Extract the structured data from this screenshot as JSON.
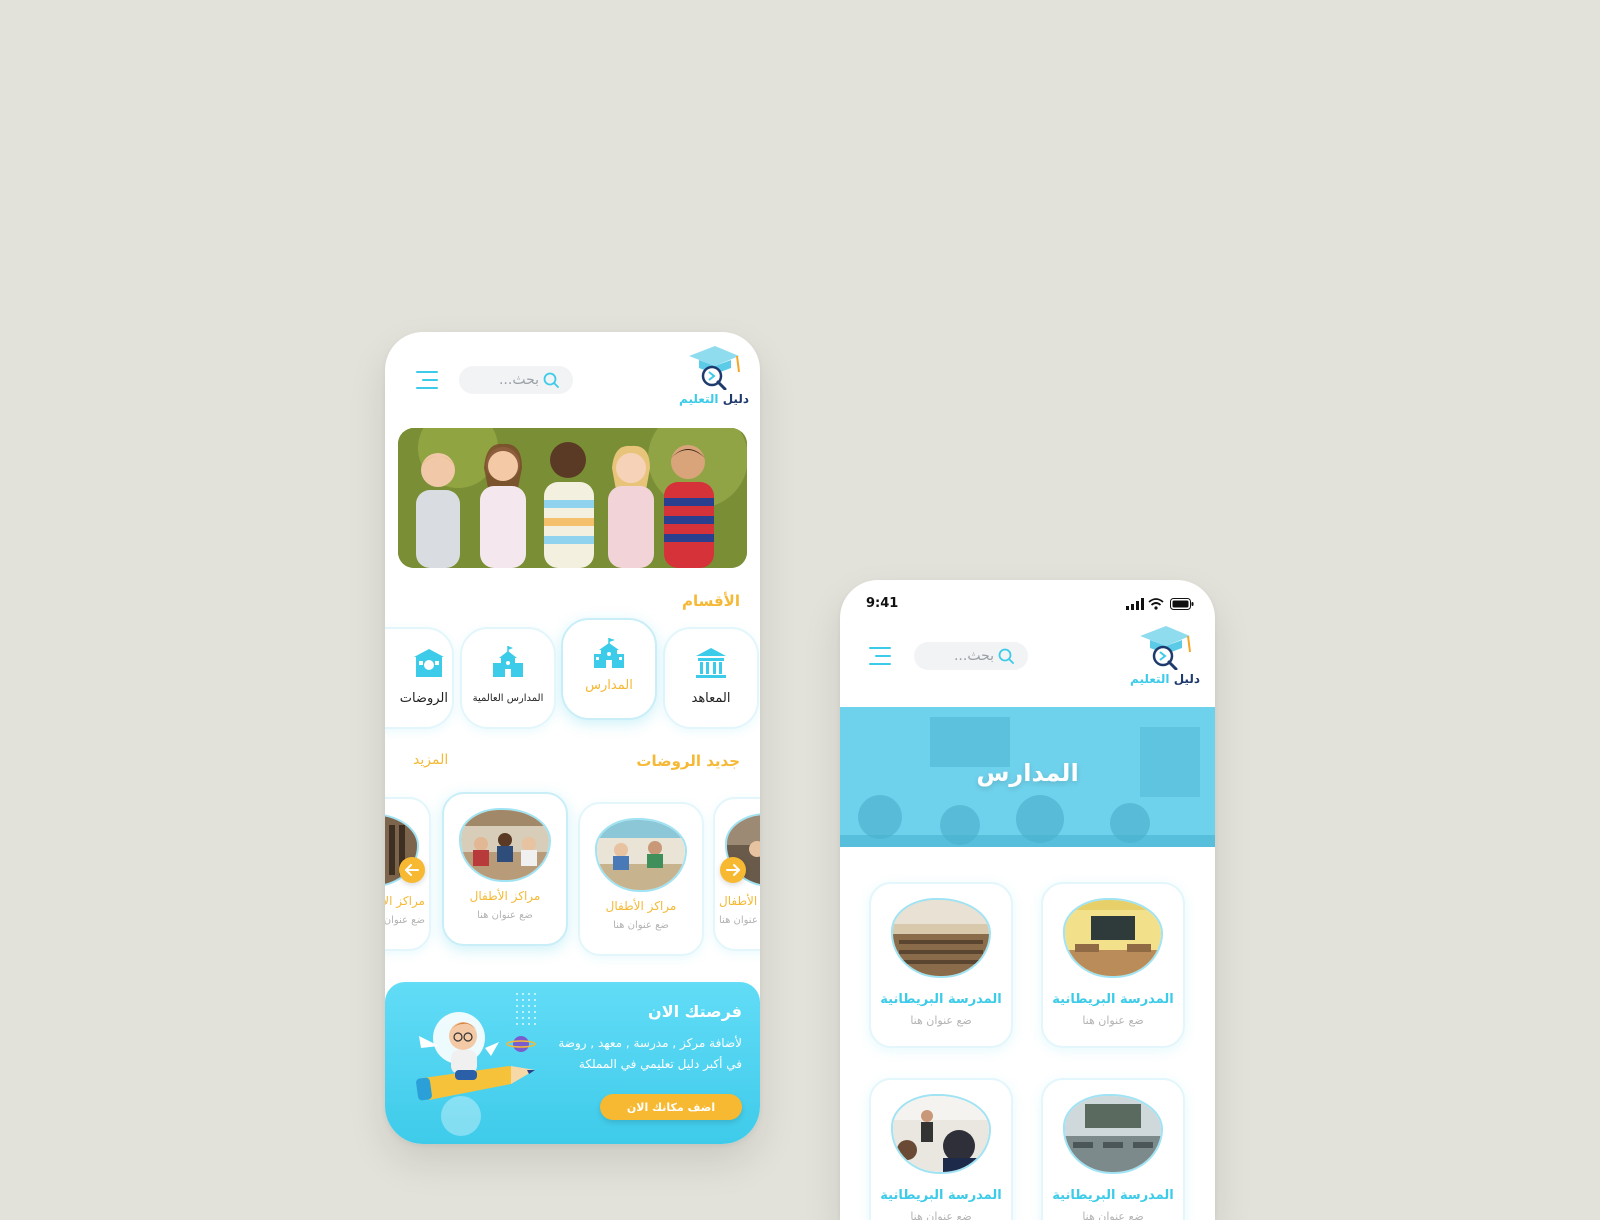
{
  "colors": {
    "primary": "#3ccbe8",
    "accent": "#f5b935",
    "navy": "#1f3a6d",
    "background": "#e2e2da"
  },
  "home": {
    "logo": {
      "name_part1": "دليل",
      "name_part2": "التعليم",
      "icon": "graduation-cap-magnifier-icon"
    },
    "search": {
      "placeholder": "بحث..."
    },
    "menu_icon": "hamburger-menu-icon",
    "categories_title": "الأقسام",
    "categories": [
      {
        "label": "المعاهد",
        "icon": "institute-icon",
        "active": false
      },
      {
        "label": "المدارس",
        "icon": "school-icon",
        "active": true
      },
      {
        "label": "المدارس العالمية",
        "icon": "international-school-icon",
        "active": false
      },
      {
        "label": "الروضات",
        "icon": "kindergarten-icon",
        "active": false
      }
    ],
    "new_title": "جديد الروضات",
    "more_label": "المزيد",
    "new_items": [
      {
        "name": "مراكز الأطفال",
        "subtitle": "ضع عنوان هنا"
      },
      {
        "name": "مراكز الأطفال",
        "subtitle": "ضع عنوان هنا"
      },
      {
        "name": "مراكز الأطفال",
        "subtitle": "ضع عنوان هنا"
      },
      {
        "name": "مراكز الأطفال",
        "subtitle": "ضع عنوان هنا"
      }
    ],
    "promo": {
      "title": "فرصتك الان",
      "line1": "لأضافة مركز , مدرسة , معهد , روضة",
      "line2": "في أكبر دليل تعليمي في المملكة",
      "button": "اضف مكانك الان"
    }
  },
  "schools": {
    "status_time": "9:41",
    "logo": {
      "name_part1": "دليل",
      "name_part2": "التعليم"
    },
    "search": {
      "placeholder": "بحث..."
    },
    "hero_title": "المدارس",
    "items": [
      {
        "name": "المدرسة البريطانية",
        "subtitle": "ضع عنوان هنا"
      },
      {
        "name": "المدرسة البريطانية",
        "subtitle": "ضع عنوان هنا"
      },
      {
        "name": "المدرسة البريطانية",
        "subtitle": "ضع عنوان هنا"
      },
      {
        "name": "المدرسة البريطانية",
        "subtitle": "ضع عنوان هنا"
      }
    ]
  }
}
